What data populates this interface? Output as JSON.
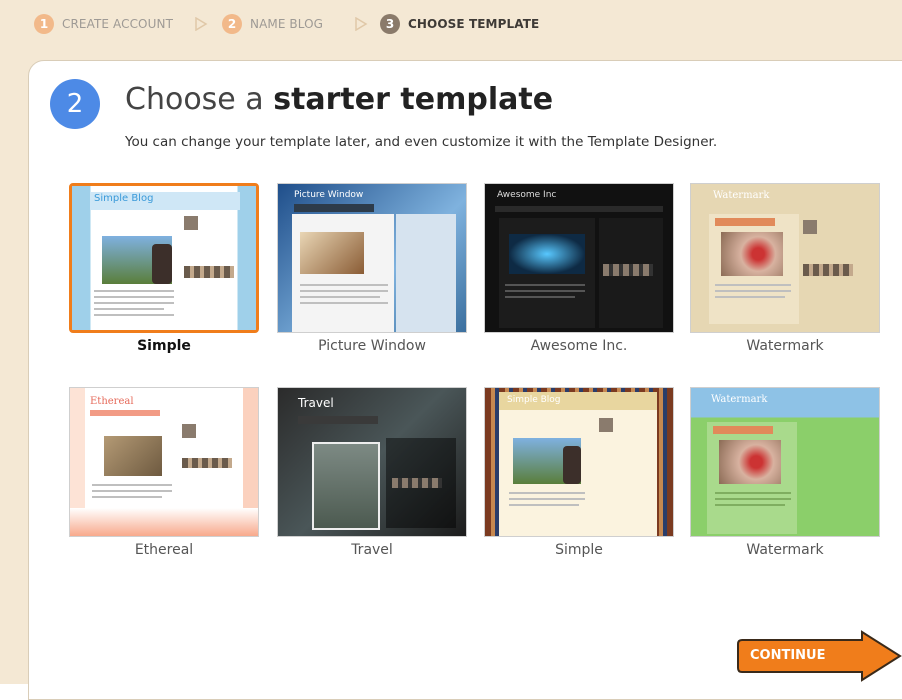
{
  "steps": [
    {
      "number": "1",
      "label": "CREATE ACCOUNT"
    },
    {
      "number": "2",
      "label": "NAME BLOG"
    },
    {
      "number": "3",
      "label": "CHOOSE TEMPLATE"
    }
  ],
  "section": {
    "number": "2",
    "heading_prefix": "Choose a",
    "heading_bold": "starter template",
    "subtext": "You can change your template later, and even customize it with the Template Designer."
  },
  "templates": [
    {
      "name": "Simple",
      "selected": true,
      "thumb_title": "Simple Blog"
    },
    {
      "name": "Picture Window",
      "selected": false,
      "thumb_title": "Picture Window"
    },
    {
      "name": "Awesome Inc.",
      "selected": false,
      "thumb_title": "Awesome Inc"
    },
    {
      "name": "Watermark",
      "selected": false,
      "thumb_title": "Watermark"
    },
    {
      "name": "Ethereal",
      "selected": false,
      "thumb_title": "Ethereal"
    },
    {
      "name": "Travel",
      "selected": false,
      "thumb_title": "Travel"
    },
    {
      "name": "Simple",
      "selected": false,
      "thumb_title": "Simple Blog"
    },
    {
      "name": "Watermark",
      "selected": false,
      "thumb_title": "Watermark"
    }
  ],
  "continue_label": "CONTINUE",
  "colors": {
    "accent_orange": "#f07d1b",
    "step_circle_inactive": "#f2b98a",
    "step_circle_active": "#8a7a6a",
    "section_blue": "#4d8ae6",
    "frame_beige": "#f4e8d4"
  }
}
